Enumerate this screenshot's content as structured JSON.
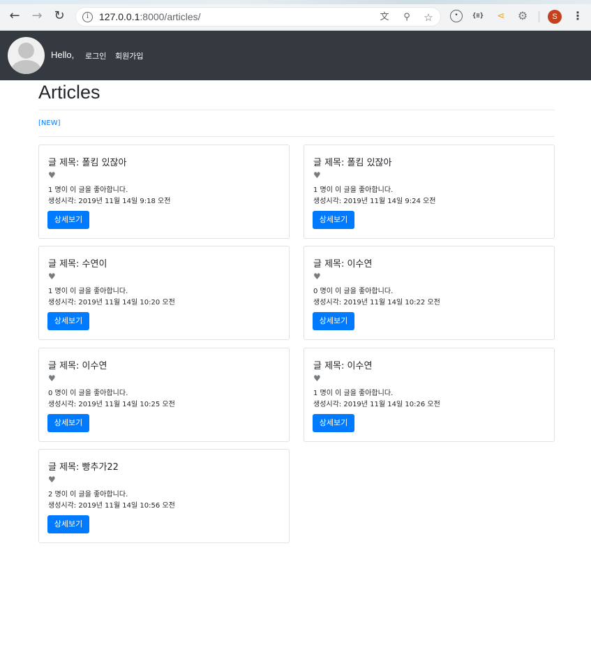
{
  "browser": {
    "url_host": "127.0.0.1",
    "url_path": ":8000/articles/",
    "profile_initial": "S"
  },
  "navbar": {
    "hello": "Hello,",
    "login": "로그인",
    "signup": "회원가입"
  },
  "page": {
    "title": "Articles",
    "new_link": "[NEW]"
  },
  "articles": [
    {
      "title": "글 제목: 폴킴 있잖아",
      "likes": "1 명이 이 글을 좋아합니다.",
      "created": "생성시각: 2019년 11월 14일 9:18 오전",
      "button": "상세보기"
    },
    {
      "title": "글 제목: 폴킴 있잖아",
      "likes": "1 명이 이 글을 좋아합니다.",
      "created": "생성시각: 2019년 11월 14일 9:24 오전",
      "button": "상세보기"
    },
    {
      "title": "글 제목: 수연이",
      "likes": "1 명이 이 글을 좋아합니다.",
      "created": "생성시각: 2019년 11월 14일 10:20 오전",
      "button": "상세보기"
    },
    {
      "title": "글 제목: 이수연",
      "likes": "0 명이 이 글을 좋아합니다.",
      "created": "생성시각: 2019년 11월 14일 10:22 오전",
      "button": "상세보기"
    },
    {
      "title": "글 제목: 이수연",
      "likes": "0 명이 이 글을 좋아합니다.",
      "created": "생성시각: 2019년 11월 14일 10:25 오전",
      "button": "상세보기"
    },
    {
      "title": "글 제목: 이수연",
      "likes": "1 명이 이 글을 좋아합니다.",
      "created": "생성시각: 2019년 11월 14일 10:26 오전",
      "button": "상세보기"
    },
    {
      "title": "글 제목: 빵추가22",
      "likes": "2 명이 이 글을 좋아합니다.",
      "created": "생성시각: 2019년 11월 14일 10:56 오전",
      "button": "상세보기"
    }
  ],
  "colors": {
    "navbar": "#343a40",
    "primary": "#007bff",
    "heart": "#777c80"
  }
}
